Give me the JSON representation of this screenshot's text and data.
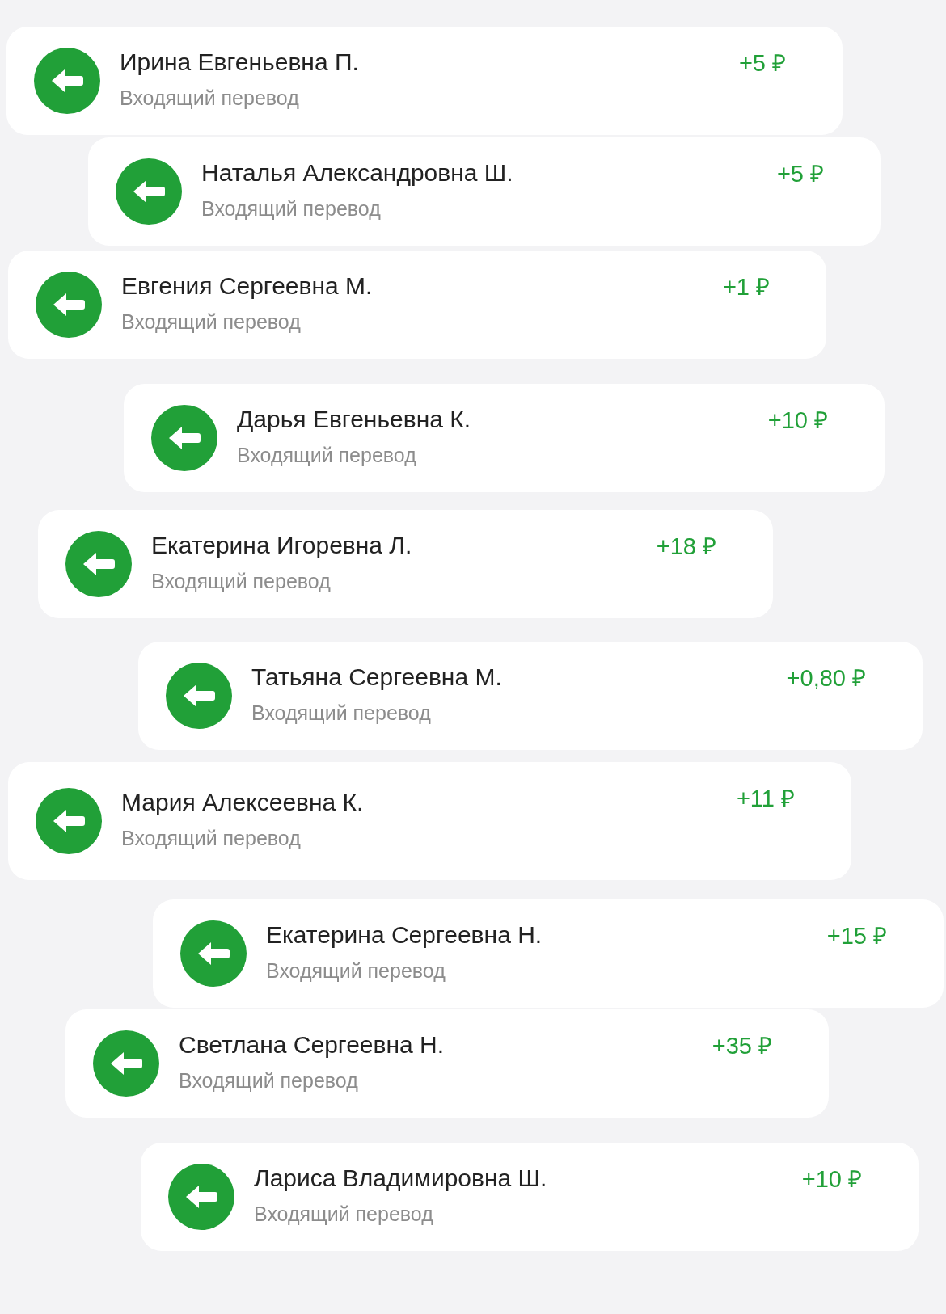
{
  "transactions": [
    {
      "name": "Ирина Евгеньевна П.",
      "subtitle": "Входящий перевод",
      "amount": "+5 ₽"
    },
    {
      "name": "Наталья Александровна Ш.",
      "subtitle": "Входящий перевод",
      "amount": "+5 ₽"
    },
    {
      "name": "Евгения Сергеевна М.",
      "subtitle": "Входящий перевод",
      "amount": "+1 ₽"
    },
    {
      "name": "Дарья Евгеньевна К.",
      "subtitle": "Входящий перевод",
      "amount": "+10 ₽"
    },
    {
      "name": "Екатерина Игоревна Л.",
      "subtitle": "Входящий перевод",
      "amount": "+18 ₽"
    },
    {
      "name": "Татьяна Сергеевна М.",
      "subtitle": "Входящий перевод",
      "amount": "+0,80 ₽"
    },
    {
      "name": "Мария Алексеевна К.",
      "subtitle": "Входящий перевод",
      "amount": "+11 ₽"
    },
    {
      "name": "Екатерина Сергеевна Н.",
      "subtitle": "Входящий перевод",
      "amount": "+15 ₽"
    },
    {
      "name": "Светлана Сергеевна Н.",
      "subtitle": "Входящий перевод",
      "amount": "+35 ₽"
    },
    {
      "name": "Лариса Владимировна Ш.",
      "subtitle": "Входящий перевод",
      "amount": "+10 ₽"
    }
  ]
}
